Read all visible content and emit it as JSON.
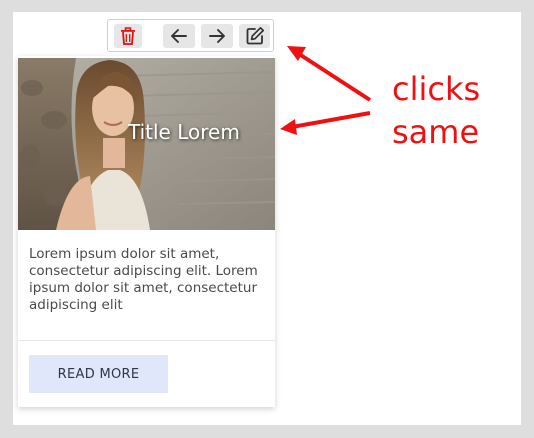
{
  "toolbar": {
    "icons": [
      "trash-icon",
      "arrow-left-icon",
      "arrow-right-icon",
      "edit-icon"
    ],
    "delete_color": "#e01010"
  },
  "card": {
    "title": "Title Lorem",
    "body": "Lorem ipsum dolor sit amet, consectetur adipiscing elit. Lorem ipsum dolor sit amet, consectetur adipiscing elit",
    "button_label": "READ MORE",
    "button_color": "#e1e7fb"
  },
  "annotation": {
    "line1": "clicks",
    "line2": "same",
    "color": "#ee1111"
  }
}
